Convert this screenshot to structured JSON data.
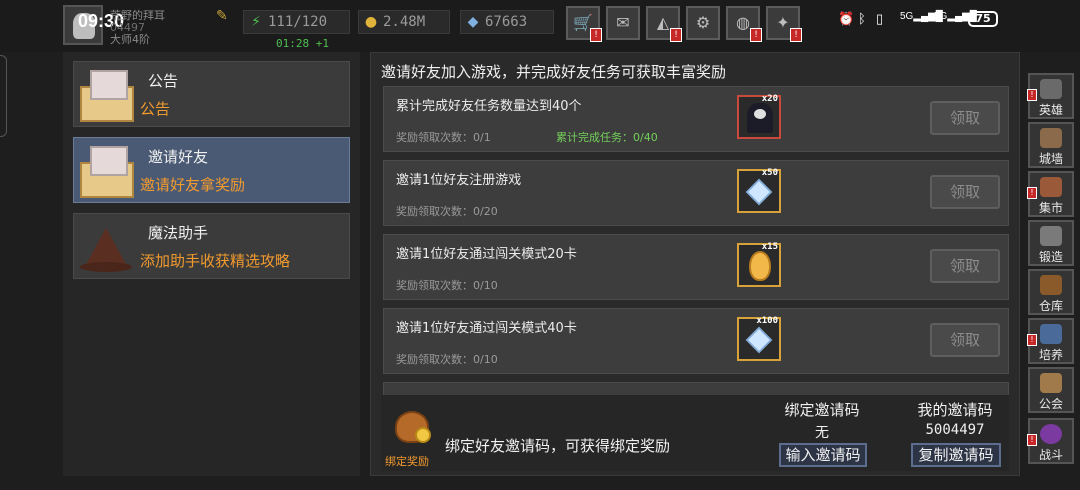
{
  "status": {
    "time": "09:30",
    "battery": "75",
    "signal1": "5G",
    "signal2": "5G"
  },
  "player": {
    "name": "荒野的拜耳",
    "uid": "04497",
    "rank": "大师4阶"
  },
  "resources": [
    {
      "icon": "lightning-icon",
      "value": "111/120",
      "color": "#4fbf52"
    },
    {
      "icon": "gold-icon",
      "value": "2.48M",
      "color": "#e0b43a"
    },
    {
      "icon": "diamond-icon",
      "value": "67663",
      "color": "#7fb0e0"
    }
  ],
  "stamina_timer": "01:28 +1",
  "top_buttons": [
    {
      "name": "shop-button",
      "icon": "cart-icon",
      "glyph": "🛒"
    },
    {
      "name": "mail-button",
      "icon": "envelope-icon",
      "glyph": "✉"
    },
    {
      "name": "gamepad-button",
      "icon": "gamepad-icon",
      "glyph": "🎮"
    },
    {
      "name": "settings-button",
      "icon": "gear-icon",
      "glyph": "⚙"
    },
    {
      "name": "wheel-button",
      "icon": "wheel-icon",
      "glyph": "◍"
    },
    {
      "name": "sparkle-button",
      "icon": "sparkle-icon",
      "glyph": "✦"
    }
  ],
  "left_menu": [
    {
      "title": "公告",
      "subtitle": "公告",
      "icon": "envelope-icon"
    },
    {
      "title": "邀请好友",
      "subtitle": "邀请好友拿奖励",
      "icon": "envelope-icon",
      "active": true
    },
    {
      "title": "魔法助手",
      "subtitle": "添加助手收获精选攻略",
      "icon": "wizard-hat-icon"
    }
  ],
  "main": {
    "title": "邀请好友加入游戏，并完成好友任务可获取丰富奖励",
    "claim_label": "领取",
    "tasks": [
      {
        "name": "累计完成好友任务数量达到40个",
        "count": "奖励领取次数：0/1",
        "extra": "累计完成任务：0/40",
        "reward_icon": "hero-icon",
        "qty": "x20"
      },
      {
        "name": "邀请1位好友注册游戏",
        "count": "奖励领取次数：0/20",
        "extra": "",
        "reward_icon": "diamond-icon",
        "qty": "x50"
      },
      {
        "name": "邀请1位好友通过闯关模式20卡",
        "count": "奖励领取次数：0/10",
        "extra": "",
        "reward_icon": "egg-icon",
        "qty": "x15"
      },
      {
        "name": "邀请1位好友通过闯关模式40卡",
        "count": "奖励领取次数：0/10",
        "extra": "",
        "reward_icon": "diamond-icon",
        "qty": "x100"
      }
    ]
  },
  "bottom": {
    "bag_label": "绑定奖励",
    "bind_text": "绑定好友邀请码，可获得绑定奖励",
    "bound_code_header": "绑定邀请码",
    "bound_code_value": "无",
    "my_code_header": "我的邀请码",
    "my_code_value": "5004497",
    "input_button": "输入邀请码",
    "copy_button": "复制邀请码"
  },
  "side_buttons": [
    {
      "label": "英雄",
      "icon": "hero-icon",
      "color": "#6a6a6a"
    },
    {
      "label": "城墙",
      "icon": "wall-icon",
      "color": "#8a6a4a"
    },
    {
      "label": "集市",
      "icon": "market-icon",
      "color": "#9a5a3a"
    },
    {
      "label": "锻造",
      "icon": "anvil-icon",
      "color": "#7a7a7a"
    },
    {
      "label": "仓库",
      "icon": "warehouse-icon",
      "color": "#8a5a2a"
    },
    {
      "label": "培养",
      "icon": "potion-icon",
      "color": "#4a6a9a"
    },
    {
      "label": "公会",
      "icon": "guild-icon",
      "color": "#a07a4a"
    },
    {
      "label": "战斗",
      "icon": "portal-icon",
      "color": "#7a3aa0"
    }
  ]
}
